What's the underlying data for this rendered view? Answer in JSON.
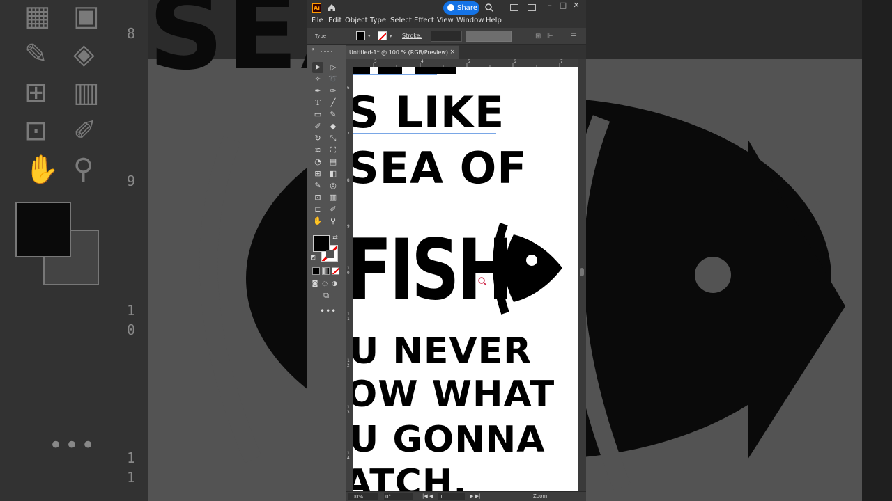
{
  "app": {
    "logo_text": "Ai",
    "share_label": "Share"
  },
  "menu": [
    "File",
    "Edit",
    "Object",
    "Type",
    "Select",
    "Effect",
    "View",
    "Window",
    "Help"
  ],
  "control_bar": {
    "selection_label": "Type",
    "stroke_label": "Stroke:"
  },
  "document": {
    "tab_title": "Untitled-1* @ 100 % (RGB/Preview)",
    "close_glyph": "×",
    "ruler_h": [
      "3",
      "4",
      "5",
      "6",
      "7"
    ],
    "ruler_v": [
      "6",
      "7",
      "8",
      "9",
      "1 0",
      "1 1",
      "1 2",
      "1 3",
      "1 4"
    ],
    "text_lines": [
      "S LIKE",
      "SEA OF",
      "FISH",
      "U NEVER",
      "OW WHAT",
      "U GONNA",
      "ATCH."
    ]
  },
  "status": {
    "zoom": "100%",
    "rotation": "0°",
    "artboard": "1",
    "tool": "Zoom"
  },
  "background": {
    "ruler_numbers": [
      "8",
      "9",
      "1 0",
      "1 1"
    ],
    "big_text": "SEA OF",
    "dots": "•••"
  },
  "colors": {
    "accent": "#1473e6",
    "ui_dark": "#323232",
    "ui_mid": "#535353",
    "artboard": "#ffffff",
    "ink": "#000000",
    "none_stroke": "#e00000"
  }
}
